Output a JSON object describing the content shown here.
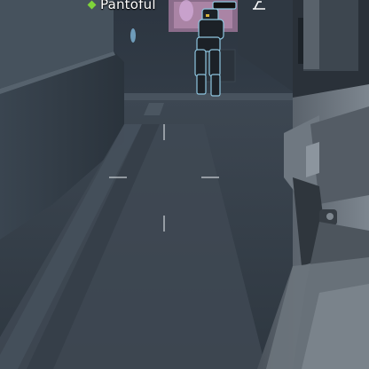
{
  "hud": {
    "teammate": {
      "name": "Pantoful",
      "marker_color": "#7fd43a"
    },
    "crosshair": {
      "color": "#dde1e6"
    },
    "objective_icon": "waypoint-icon"
  },
  "scene": {
    "description_colors": {
      "wall": "#3b4550",
      "floor": "#36404a",
      "weapon": "#808891"
    }
  }
}
